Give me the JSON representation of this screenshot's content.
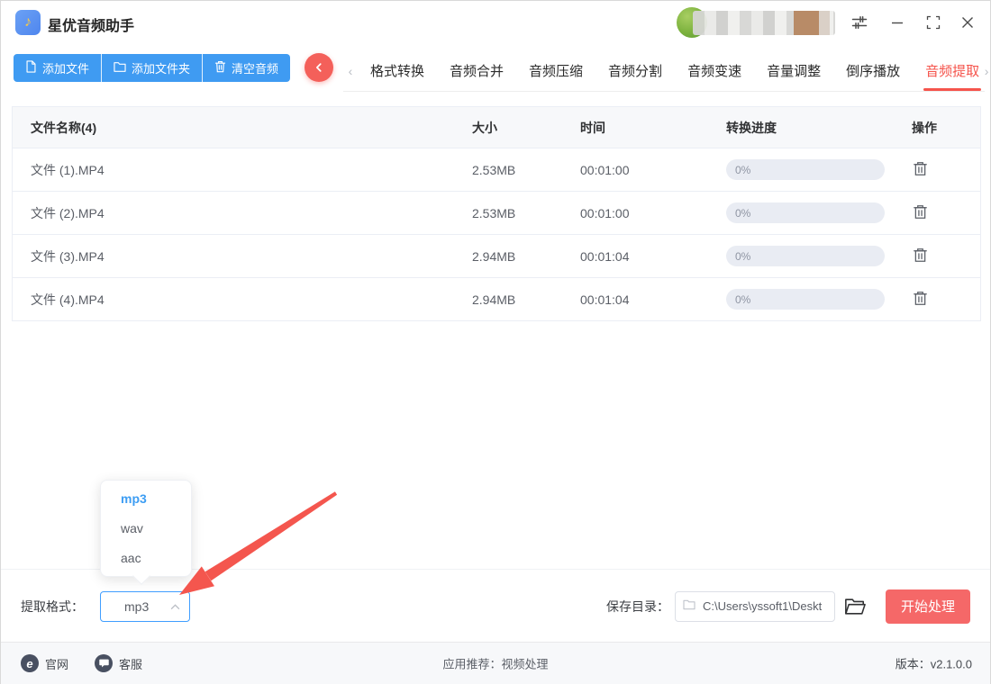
{
  "app": {
    "title": "星优音频助手"
  },
  "toolbar": {
    "add_file": "添加文件",
    "add_folder": "添加文件夹",
    "clear_audio": "清空音频"
  },
  "tabs": {
    "items": [
      {
        "label": "格式转换"
      },
      {
        "label": "音频合并"
      },
      {
        "label": "音频压缩"
      },
      {
        "label": "音频分割"
      },
      {
        "label": "音频变速"
      },
      {
        "label": "音量调整"
      },
      {
        "label": "倒序播放"
      },
      {
        "label": "音频提取",
        "active": true
      }
    ]
  },
  "table": {
    "headers": {
      "name": "文件名称(4)",
      "size": "大小",
      "time": "时间",
      "progress": "转换进度",
      "action": "操作"
    },
    "rows": [
      {
        "name": "文件 (1).MP4",
        "size": "2.53MB",
        "time": "00:01:00",
        "progress": "0%"
      },
      {
        "name": "文件 (2).MP4",
        "size": "2.53MB",
        "time": "00:01:00",
        "progress": "0%"
      },
      {
        "name": "文件 (3).MP4",
        "size": "2.94MB",
        "time": "00:01:04",
        "progress": "0%"
      },
      {
        "name": "文件 (4).MP4",
        "size": "2.94MB",
        "time": "00:01:04",
        "progress": "0%"
      }
    ]
  },
  "format": {
    "label": "提取格式：",
    "value": "mp3",
    "options": [
      {
        "label": "mp3",
        "selected": true
      },
      {
        "label": "wav"
      },
      {
        "label": "aac"
      }
    ]
  },
  "save_dir": {
    "label": "保存目录：",
    "path": "C:\\Users\\yssoft1\\Deskt"
  },
  "process": {
    "start_label": "开始处理"
  },
  "footer": {
    "site": "官网",
    "service": "客服",
    "recommend_label": "应用推荐：",
    "recommend_link": "视频处理",
    "version": "版本：v2.1.0.0"
  },
  "colors": {
    "accent_blue": "#3f9bf2",
    "accent_red": "#f5544c",
    "button_red": "#f56868",
    "progress_bg": "#e9ecf3"
  }
}
